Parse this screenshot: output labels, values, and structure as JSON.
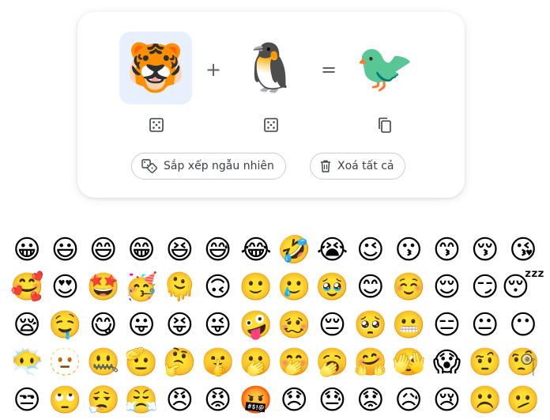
{
  "mixer": {
    "left_emoji": "🐯",
    "right_emoji": "🐧",
    "result_emoji": "🐦",
    "plus_sign": "+",
    "equals_sign": "=",
    "left_icon": "dice-icon",
    "right_icon": "dice-icon",
    "result_icon": "copy-icon",
    "result_tint": "#f26b1d"
  },
  "buttons": {
    "shuffle_label": "Sắp xếp ngẫu nhiên",
    "shuffle_icon": "shuffle-dice-icon",
    "clear_label": "Xoá tất cả",
    "clear_icon": "trash-icon"
  },
  "emoji_grid": [
    "😀",
    "😃",
    "😄",
    "😁",
    "😆",
    "😅",
    "😂",
    "🤣",
    "😭",
    "😉",
    "😗",
    "😙",
    "😚",
    "😘",
    "🥰",
    "😍",
    "🤩",
    "🥳",
    "🫠",
    "🙃",
    "🙂",
    "🥲",
    "🥹",
    "😊",
    "☺️",
    "😌",
    "😏",
    "😴",
    "😪",
    "🤤",
    "😋",
    "😛",
    "😝",
    "😜",
    "🤪",
    "🥴",
    "😔",
    "🥺",
    "😬",
    "😑",
    "😐",
    "😶",
    "😶‍🌫️",
    "🫥",
    "🤐",
    "🫡",
    "🤔",
    "🤫",
    "🫢",
    "🤭",
    "🥱",
    "🤗",
    "🫣",
    "😱",
    "🤨",
    "🧐",
    "😒",
    "🙄",
    "😮‍💨",
    "😤",
    "😠",
    "😡",
    "🤬",
    "😞",
    "😓",
    "😟",
    "😥",
    "😢",
    "☹️",
    "🫤"
  ],
  "colors": {
    "selected_slot": "#e8effd",
    "card_border": "#c9ccd1",
    "icon_gray": "#5f6368"
  }
}
